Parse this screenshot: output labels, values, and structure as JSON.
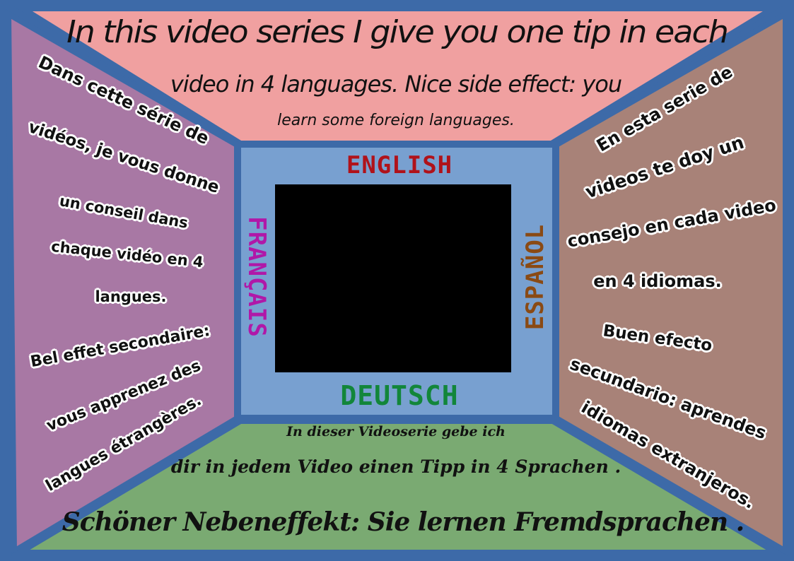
{
  "colors": {
    "frame": "#3d6aa8",
    "top_panel": "#f0a0a0",
    "left_panel": "#a878a4",
    "right_panel": "#a88278",
    "bottom_panel": "#7aaa72",
    "center_panel": "#78a0d0",
    "screen": "#000000",
    "english": "#b0121a",
    "francais": "#b018a8",
    "espanol": "#8a4a14",
    "deutsch": "#12863a"
  },
  "top_text": [
    "In this video series I give you one tip in each",
    "video in 4 languages. Nice side effect: you",
    "learn some foreign languages."
  ],
  "left_text": [
    "Dans cette série de",
    "vidéos, je vous donne",
    "un conseil dans",
    "chaque vidéo en 4",
    "langues.",
    "Bel effet secondaire:",
    "vous apprenez des",
    "langues étrangères."
  ],
  "right_text": [
    "En esta serie de",
    "videos te doy un",
    "consejo en cada video",
    "en 4 idiomas.",
    "Buen efecto",
    "secundario: aprendes",
    "idiomas extranjeros."
  ],
  "bottom_text": [
    "In dieser Videoserie gebe ich",
    "dir in jedem Video einen Tipp in 4 Sprachen .",
    "Schöner Nebeneffekt: Sie lernen Fremdsprachen ."
  ],
  "languages": {
    "english": "ENGLISH",
    "francais": "FRANÇAIS",
    "espanol": "ESPAÑOL",
    "deutsch": "DEUTSCH"
  }
}
